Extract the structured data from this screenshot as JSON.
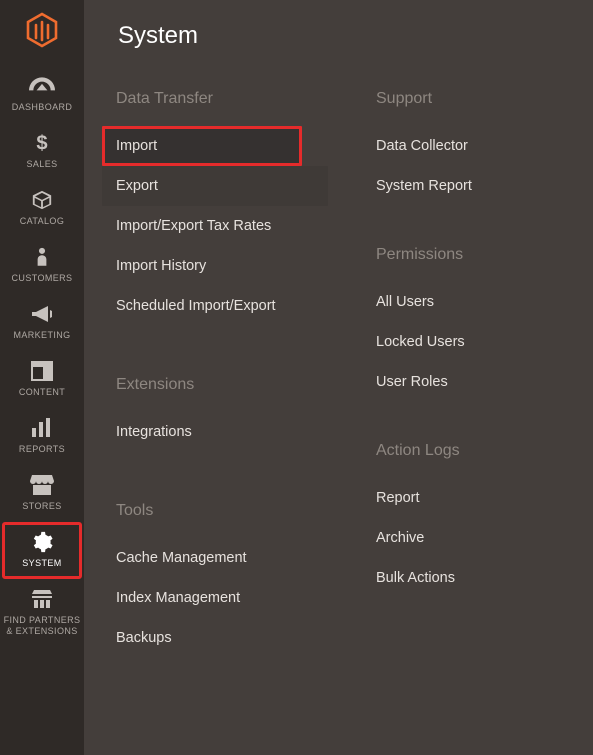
{
  "page_title": "System",
  "sidebar": {
    "items": [
      {
        "key": "dashboard",
        "label": "DASHBOARD"
      },
      {
        "key": "sales",
        "label": "SALES"
      },
      {
        "key": "catalog",
        "label": "CATALOG"
      },
      {
        "key": "customers",
        "label": "CUSTOMERS"
      },
      {
        "key": "marketing",
        "label": "MARKETING"
      },
      {
        "key": "content",
        "label": "CONTENT"
      },
      {
        "key": "reports",
        "label": "REPORTS"
      },
      {
        "key": "stores",
        "label": "STORES"
      },
      {
        "key": "system",
        "label": "SYSTEM"
      },
      {
        "key": "find_partners",
        "label": "FIND PARTNERS\n& EXTENSIONS"
      }
    ],
    "active": "system"
  },
  "flyout": {
    "col1": [
      {
        "title": "Data Transfer",
        "items": [
          {
            "label": "Import",
            "highlighted": true
          },
          {
            "label": "Export",
            "shaded": true
          },
          {
            "label": "Import/Export Tax Rates"
          },
          {
            "label": "Import History"
          },
          {
            "label": "Scheduled Import/Export"
          }
        ]
      },
      {
        "title": "Extensions",
        "items": [
          {
            "label": "Integrations"
          }
        ]
      },
      {
        "title": "Tools",
        "items": [
          {
            "label": "Cache Management"
          },
          {
            "label": "Index Management"
          },
          {
            "label": "Backups"
          }
        ]
      }
    ],
    "col2": [
      {
        "title": "Support",
        "items": [
          {
            "label": "Data Collector"
          },
          {
            "label": "System Report"
          }
        ]
      },
      {
        "title": "Permissions",
        "items": [
          {
            "label": "All Users"
          },
          {
            "label": "Locked Users"
          },
          {
            "label": "User Roles"
          }
        ]
      },
      {
        "title": "Action Logs",
        "items": [
          {
            "label": "Report"
          },
          {
            "label": "Archive"
          },
          {
            "label": "Bulk Actions"
          }
        ]
      }
    ]
  }
}
